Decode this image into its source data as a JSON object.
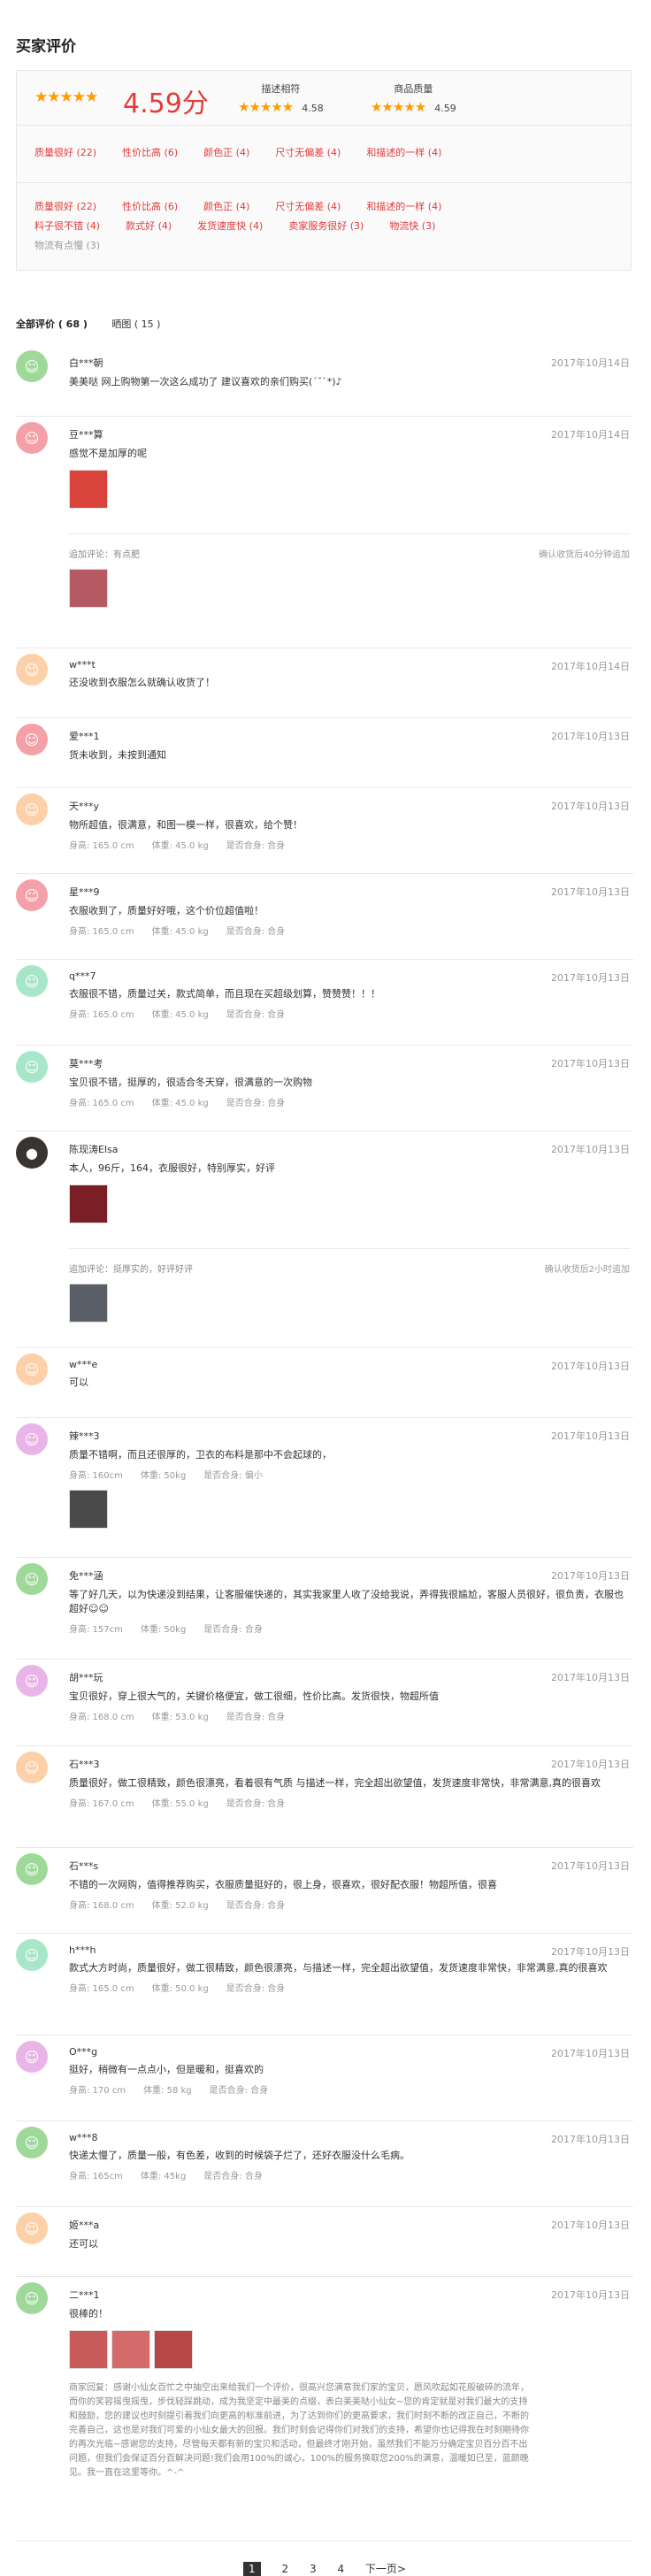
{
  "title": "买家评价",
  "summary": {
    "score": "4.59分",
    "desc_label": "描述相符",
    "desc_score": "4.58",
    "quality_label": "商品质量",
    "quality_score": "4.59",
    "tags1": [
      "质量很好 (22)",
      "性价比高 (6)",
      "颜色正 (4)",
      "尺寸无偏差 (4)",
      "和描述的一样 (4)"
    ],
    "tags2": [
      "质量很好 (22)",
      "性价比高 (6)",
      "颜色正 (4)",
      "尺寸无偏差 (4)",
      "和描述的一样 (4)",
      "料子很不错 (4)",
      "款式好 (4)",
      "发货速度快 (4)",
      "卖家服务很好 (3)",
      "物流快 (3)"
    ],
    "tag_gray": "物流有点慢 (3)"
  },
  "filter": {
    "all": "全部评价 ( 68 )",
    "pics": "晒图 ( 15 )"
  },
  "colors": {
    "accent": "#e23c3c",
    "star": "#ff9a00"
  },
  "reviews": [
    {
      "user": "白***朝",
      "date": "2017年10月14日",
      "text": "美美哒 网上购物第一次这么成功了 建议喜欢的亲们购买(ˊ˘ˋ*)♪"
    },
    {
      "user": "豆***算",
      "date": "2017年10月14日",
      "text": "感觉不是加厚的呢",
      "add_label": "追加评论：有点肥",
      "add_date": "确认收货后40分钟追加"
    },
    {
      "user": "w***t",
      "date": "2017年10月14日",
      "text": "还没收到衣服怎么就确认收货了！"
    },
    {
      "user": "爱***1",
      "date": "2017年10月13日",
      "text": "货未收到，未按到通知"
    },
    {
      "user": "天***y",
      "date": "2017年10月13日",
      "text": "物所超值，很满意，和图一模一样，很喜欢，给个赞！",
      "height": "身高: 165.0 cm",
      "weight": "体重: 45.0 kg",
      "fit": "是否合身: 合身"
    },
    {
      "user": "星***9",
      "date": "2017年10月13日",
      "text": "衣服收到了，质量好好哦，这个价位超值啦！",
      "height": "身高: 165.0 cm",
      "weight": "体重: 45.0 kg",
      "fit": "是否合身: 合身"
    },
    {
      "user": "q***7",
      "date": "2017年10月13日",
      "text": "衣服很不错，质量过关，款式简单，而且现在买超级划算，赞赞赞！！！",
      "height": "身高: 165.0 cm",
      "weight": "体重: 45.0 kg",
      "fit": "是否合身: 合身"
    },
    {
      "user": "莫***考",
      "date": "2017年10月13日",
      "text": "宝贝很不错，挺厚的，很适合冬天穿，很满意的一次购物",
      "height": "身高: 165.0 cm",
      "weight": "体重: 45.0 kg",
      "fit": "是否合身: 合身"
    },
    {
      "user": "陈现涛Elsa",
      "date": "2017年10月13日",
      "text": "本人，96斤，164，衣服很好，特别厚实，好评",
      "add_label": "追加评论：挺厚实的，好评好评",
      "add_date": "确认收货后2小时追加"
    },
    {
      "user": "w***e",
      "date": "2017年10月13日",
      "text": "可以"
    },
    {
      "user": "辣***3",
      "date": "2017年10月13日",
      "text": "质量不错啊，而且还很厚的，卫衣的布料是那中不会起球的，",
      "height": "身高: 160cm",
      "weight": "体重: 50kg",
      "fit": "是否合身: 偏小"
    },
    {
      "user": "免***涵",
      "date": "2017年10月13日",
      "text": "等了好几天，以为快递没到结果，让客服催快递的，其实我家里人收了没给我说，弄得我很尴尬，客服人员很好，很负责，衣服也超好☺☺",
      "height": "身高: 157cm",
      "weight": "体重: 50kg",
      "fit": "是否合身: 合身"
    },
    {
      "user": "胡***玩",
      "date": "2017年10月13日",
      "text": "宝贝很好，穿上很大气的，关键价格便宜，做工很细，性价比高。发货很快，物超所值",
      "height": "身高: 168.0 cm",
      "weight": "体重: 53.0 kg",
      "fit": "是否合身: 合身"
    },
    {
      "user": "石***3",
      "date": "2017年10月13日",
      "text": "质量很好，做工很精致，颜色很漂亮，看着很有气质 与描述一样，完全超出欲望值，发货速度非常快，非常满意,真的很喜欢",
      "height": "身高: 167.0 cm",
      "weight": "体重: 55.0 kg",
      "fit": "是否合身: 合身"
    },
    {
      "user": "石***s",
      "date": "2017年10月13日",
      "text": "不错的一次网购，值得推荐购买，衣服质量挺好的，很上身，很喜欢，很好配衣服！物超所值，很喜",
      "height": "身高: 168.0 cm",
      "weight": "体重: 52.0 kg",
      "fit": "是否合身: 合身"
    },
    {
      "user": "h***h",
      "date": "2017年10月13日",
      "text": "款式大方时尚，质量很好，做工很精致，颜色很漂亮，与描述一样，完全超出欲望值，发货速度非常快，非常满意,真的很喜欢",
      "height": "身高: 165.0 cm",
      "weight": "体重: 50.0 kg",
      "fit": "是否合身: 合身"
    },
    {
      "user": "O***g",
      "date": "2017年10月13日",
      "text": "挺好，稍微有一点点小，但是暖和，挺喜欢的",
      "height": "身高: 170 cm",
      "weight": "体重: 58 kg",
      "fit": "是否合身: 合身"
    },
    {
      "user": "w***8",
      "date": "2017年10月13日",
      "text": "快递太慢了，质量一般，有色差，收到的时候袋子烂了，还好衣服没什么毛病。",
      "height": "身高: 165cm",
      "weight": "体重: 45kg",
      "fit": "是否合身: 合身"
    },
    {
      "user": "姬***a",
      "date": "2017年10月13日",
      "text": "还可以"
    },
    {
      "user": "二***1",
      "date": "2017年10月13日",
      "text": "很棒的！",
      "reply": "商家回复：感谢小仙女百忙之中抽空出来给我们一个评价，很高兴您满意我们家的宝贝，愿风吹起如花般破碎的流年，而你的笑容摇曳摇曳，步伐轻踩跳动，成为我坚定中最美的点缀，表白美美哒小仙女~您的肯定就是对我们最大的支持和鼓励，您的建议也时刻提引着我们向更高的标准前进，为了达到你们的更高要求，我们时刻不断的改正自己，不断的完善自己，这也是对我们可爱的小仙女最大的回报。我们时刻会记得你们对我们的支持，希望你也记得我在时刻期待你的再次光临~感谢您的支持，尽管每天都有新的宝贝和活动，但最终才刚开始，虽然我们不能万分确定宝贝百分百不出问题，但我们会保证百分百解决问题!我们会用100%的诚心，100%的服务换取您200%的满意，温暖如已至，蓝颜晚见。我一直在这里等你。^-^"
    }
  ],
  "pager": {
    "p1": "1",
    "p2": "2",
    "p3": "3",
    "p4": "4",
    "next": "下一页>"
  }
}
